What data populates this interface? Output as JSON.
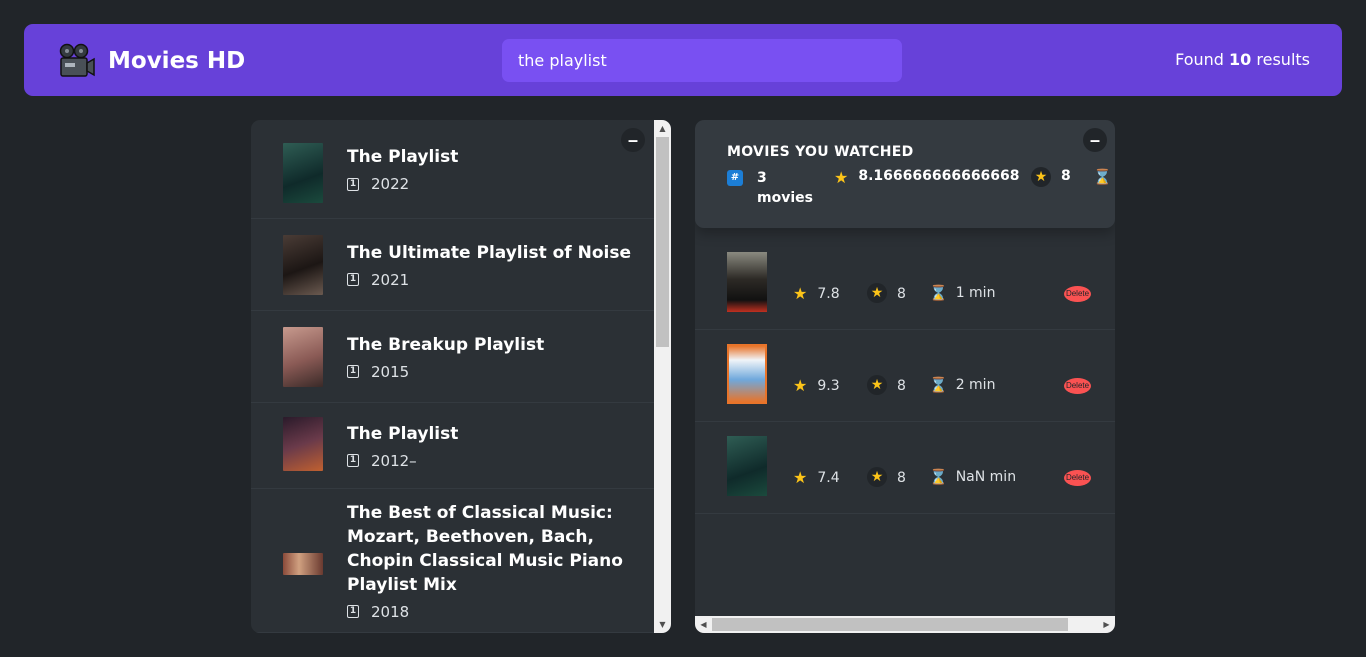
{
  "nav": {
    "logo_icon": "movie-camera-icon",
    "title": "Movies HD",
    "search_value": "the playlist",
    "results_prefix": "Found ",
    "results_count": "10",
    "results_suffix": " results"
  },
  "list": {
    "toggle_label": "–",
    "movies": [
      {
        "title": "The Playlist",
        "year": "2022",
        "poster_color": "#1d4a43"
      },
      {
        "title": "The Ultimate Playlist of Noise",
        "year": "2021",
        "poster_color": "#3a2a28"
      },
      {
        "title": "The Breakup Playlist",
        "year": "2015",
        "poster_color": "#8a5a55"
      },
      {
        "title": "The Playlist",
        "year": "2012–",
        "poster_color": "#4a2a3a"
      },
      {
        "title": "The Best of Classical Music: Mozart, Beethoven, Bach, Chopin Classical Music Piano Playlist Mix",
        "year": "2018",
        "poster_color": "#6a3a30"
      }
    ]
  },
  "summary": {
    "toggle_label": "–",
    "title": "MOVIES YOU WATCHED",
    "count": "3",
    "count_unit": "movies",
    "avg_imdb": "8.166666666666668",
    "avg_user": "8",
    "avg_runtime": ""
  },
  "watched": [
    {
      "imdb": "7.8",
      "user": "8",
      "runtime": "1 min",
      "poster_color": "#2d2a26",
      "delete_label": "Delete"
    },
    {
      "imdb": "9.3",
      "user": "8",
      "runtime": "2 min",
      "poster_color": "#e8742a",
      "delete_label": "Delete"
    },
    {
      "imdb": "7.4",
      "user": "8",
      "runtime": "NaN min",
      "poster_color": "#1d4a43",
      "delete_label": "Delete"
    }
  ],
  "colors": {
    "nav": "#6741d9",
    "search": "#7950f2",
    "background": "#212529",
    "box": "#2b3035",
    "delete": "#fa5252",
    "star": "#fcc419"
  }
}
